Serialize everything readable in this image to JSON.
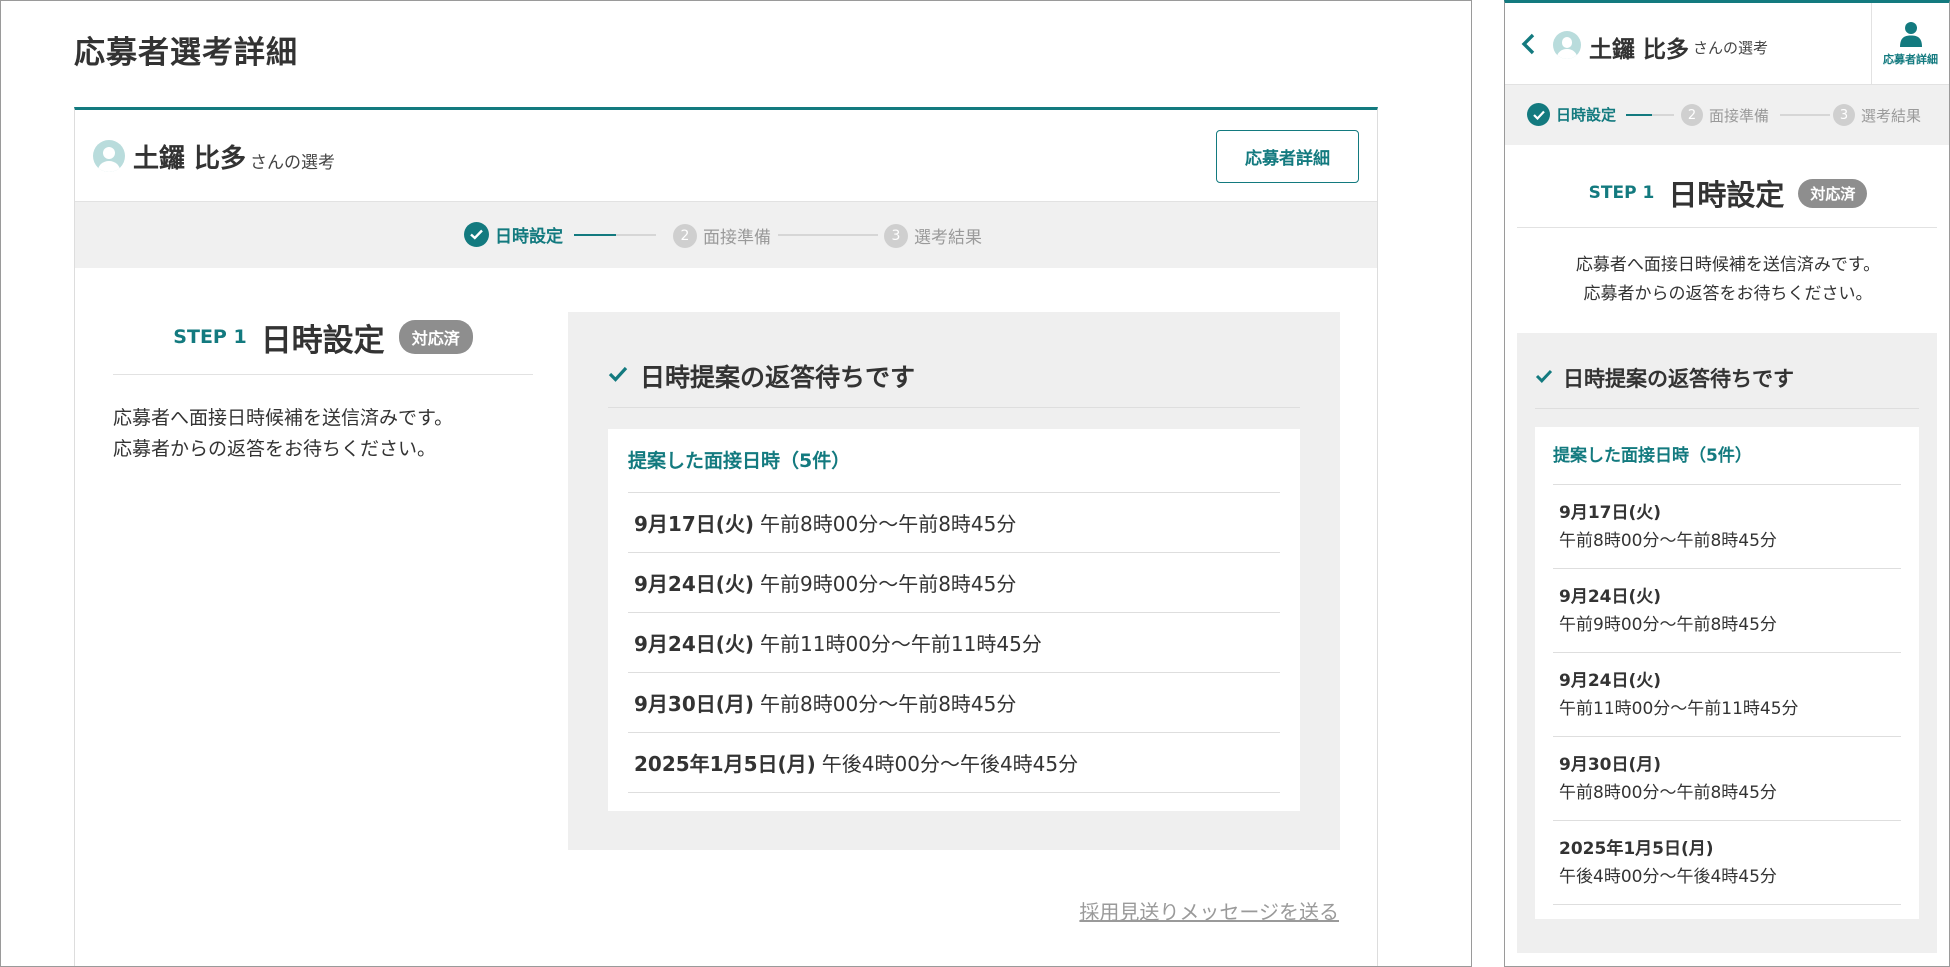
{
  "page": {
    "title": "応募者選考詳細"
  },
  "candidate": {
    "name": "土鑼 比多",
    "suffix": "さんの選考"
  },
  "header": {
    "detail_button": "応募者詳細",
    "mobile_detail_label": "応募者詳細"
  },
  "stepper": [
    {
      "number": "1",
      "label": "日時設定",
      "state": "done"
    },
    {
      "number": "2",
      "label": "面接準備",
      "state": "pending"
    },
    {
      "number": "3",
      "label": "選考結果",
      "state": "pending"
    }
  ],
  "step": {
    "label": "STEP 1",
    "title": "日時設定",
    "badge": "対応済",
    "description_line1": "応募者へ面接日時候補を送信済みです。",
    "description_line2": "応募者からの返答をお待ちください。"
  },
  "waiting": {
    "title": "日時提案の返答待ちです",
    "slots_title": "提案した面接日時（5件）",
    "slots": [
      {
        "date": "9月17日(火)",
        "time": "午前8時00分〜午前8時45分"
      },
      {
        "date": "9月24日(火)",
        "time": "午前9時00分〜午前8時45分"
      },
      {
        "date": "9月24日(火)",
        "time": "午前11時00分〜午前11時45分"
      },
      {
        "date": "9月30日(月)",
        "time": "午前8時00分〜午前8時45分"
      },
      {
        "date": "2025年1月5日(月)",
        "time": "午後4時00分〜午後4時45分"
      }
    ]
  },
  "footer": {
    "reject_link": "採用見送りメッセージを送る"
  },
  "colors": {
    "accent": "#137a7f",
    "badge": "#8e8e8e",
    "panel_bg": "#efefef",
    "muted": "#9a9a9a"
  },
  "icons": [
    "person-avatar-icon",
    "check-circle-icon",
    "check-icon",
    "chevron-left-icon",
    "person-icon"
  ]
}
